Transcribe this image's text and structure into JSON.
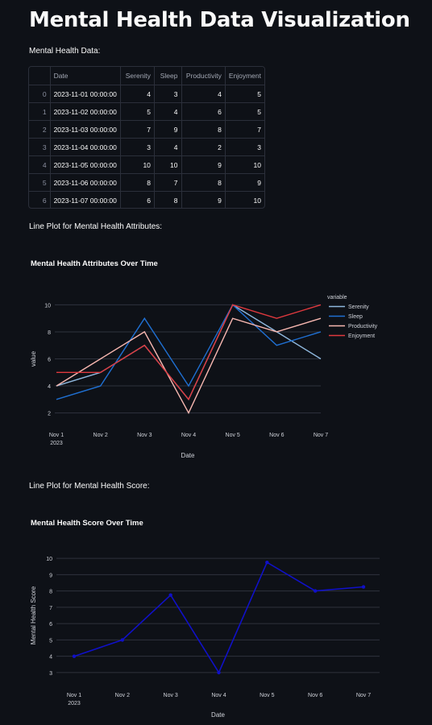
{
  "page": {
    "title": "Mental Health Data Visualization",
    "data_label": "Mental Health Data:",
    "line_label_1": "Line Plot for Mental Health Attributes:",
    "line_label_2": "Line Plot for Mental Health Score:"
  },
  "table": {
    "headers": [
      "",
      "Date",
      "Serenity",
      "Sleep",
      "Productivity",
      "Enjoyment"
    ],
    "rows": [
      [
        "0",
        "2023-11-01 00:00:00",
        "4",
        "3",
        "4",
        "5"
      ],
      [
        "1",
        "2023-11-02 00:00:00",
        "5",
        "4",
        "6",
        "5"
      ],
      [
        "2",
        "2023-11-03 00:00:00",
        "7",
        "9",
        "8",
        "7"
      ],
      [
        "3",
        "2023-11-04 00:00:00",
        "3",
        "4",
        "2",
        "3"
      ],
      [
        "4",
        "2023-11-05 00:00:00",
        "10",
        "10",
        "9",
        "10"
      ],
      [
        "5",
        "2023-11-06 00:00:00",
        "8",
        "7",
        "8",
        "9"
      ],
      [
        "6",
        "2023-11-07 00:00:00",
        "6",
        "8",
        "9",
        "10"
      ]
    ]
  },
  "chart_data": [
    {
      "type": "line",
      "title": "Mental Health Attributes Over Time",
      "xlabel": "Date",
      "ylabel": "value",
      "categories": [
        "Nov 1",
        "Nov 2",
        "Nov 3",
        "Nov 4",
        "Nov 5",
        "Nov 6",
        "Nov 7"
      ],
      "x_sub": "2023",
      "yticks": [
        2,
        4,
        6,
        8,
        10
      ],
      "ylim": [
        1.5,
        10.5
      ],
      "legend_title": "variable",
      "legend_position": "right",
      "grid": true,
      "series": [
        {
          "name": "Serenity",
          "color": "#8fb8de",
          "values": [
            4,
            5,
            7,
            3,
            10,
            8,
            6
          ]
        },
        {
          "name": "Sleep",
          "color": "#1f6fd1",
          "values": [
            3,
            4,
            9,
            4,
            10,
            7,
            8
          ]
        },
        {
          "name": "Productivity",
          "color": "#f7b7b0",
          "values": [
            4,
            6,
            8,
            2,
            9,
            8,
            9
          ]
        },
        {
          "name": "Enjoyment",
          "color": "#e0393e",
          "values": [
            5,
            5,
            7,
            3,
            10,
            9,
            10
          ]
        }
      ]
    },
    {
      "type": "line",
      "title": "Mental Health Score Over Time",
      "xlabel": "Date",
      "ylabel": "Mental Health Score",
      "categories": [
        "Nov 1",
        "Nov 2",
        "Nov 3",
        "Nov 4",
        "Nov 5",
        "Nov 6",
        "Nov 7"
      ],
      "x_sub": "2023",
      "yticks": [
        3,
        4,
        5,
        6,
        7,
        8,
        9,
        10
      ],
      "ylim": [
        2.7,
        10.3
      ],
      "grid": true,
      "series": [
        {
          "name": "",
          "color": "#1010c8",
          "values": [
            4,
            5,
            7.75,
            3,
            9.75,
            8,
            8.25
          ]
        }
      ]
    }
  ]
}
